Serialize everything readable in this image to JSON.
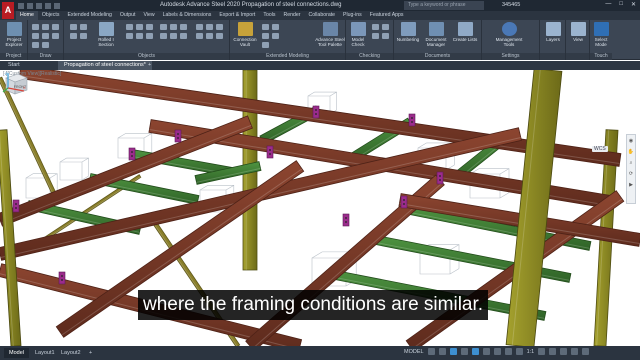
{
  "app": {
    "logo": "A",
    "title": "Autodesk Advance Steel 2020    Propagation of steel connections.dwg",
    "search_placeholder": "Type a keyword or phrase",
    "user": "345465"
  },
  "ribbon_tabs": [
    "Home",
    "Objects",
    "Extended Modeling",
    "Output",
    "View",
    "Labels & Dimensions",
    "Export & Import",
    "Tools",
    "Render",
    "Collaborate",
    "Plug-ins",
    "Featured Apps"
  ],
  "ribbon_groups": [
    {
      "label": "Project",
      "buttons": [
        "Project Explorer"
      ]
    },
    {
      "label": "Draw"
    },
    {
      "label": "Objects",
      "buttons": [
        "Rolled I Section"
      ]
    },
    {
      "label": "Extended Modeling",
      "buttons": [
        "Connection Vault",
        "Advance Steel Tool Palette"
      ]
    },
    {
      "label": "Checking",
      "buttons": [
        "Model Check"
      ]
    },
    {
      "label": "Documents",
      "buttons": [
        "Numbering",
        "Document Manager",
        "Create Lists"
      ]
    },
    {
      "label": "Settings",
      "buttons": [
        "Management Tools"
      ]
    },
    {
      "label": "",
      "buttons": [
        "Layers"
      ]
    },
    {
      "label": "",
      "buttons": [
        "View"
      ]
    },
    {
      "label": "Touch",
      "buttons": [
        "Select Mode"
      ]
    }
  ],
  "doc_tabs": [
    "Start",
    "Propagation of steel connections*"
  ],
  "viewport_label": "[-][Custom View][Realistic]",
  "viewcube_label": "FRONT",
  "wcs_label": "WCS",
  "subtitle": "where the framing conditions are similar.",
  "layout_tabs": [
    "Model",
    "Layout1",
    "Layout2"
  ],
  "status": {
    "model_label": "MODEL",
    "scale": "1:1"
  },
  "colors": {
    "beam": "#7a3a28",
    "beam_dark": "#4e2217",
    "joist": "#3f7f34",
    "column": "#8f8c22",
    "brace": "#8a7f2a",
    "plate": "#9b2c8c"
  }
}
